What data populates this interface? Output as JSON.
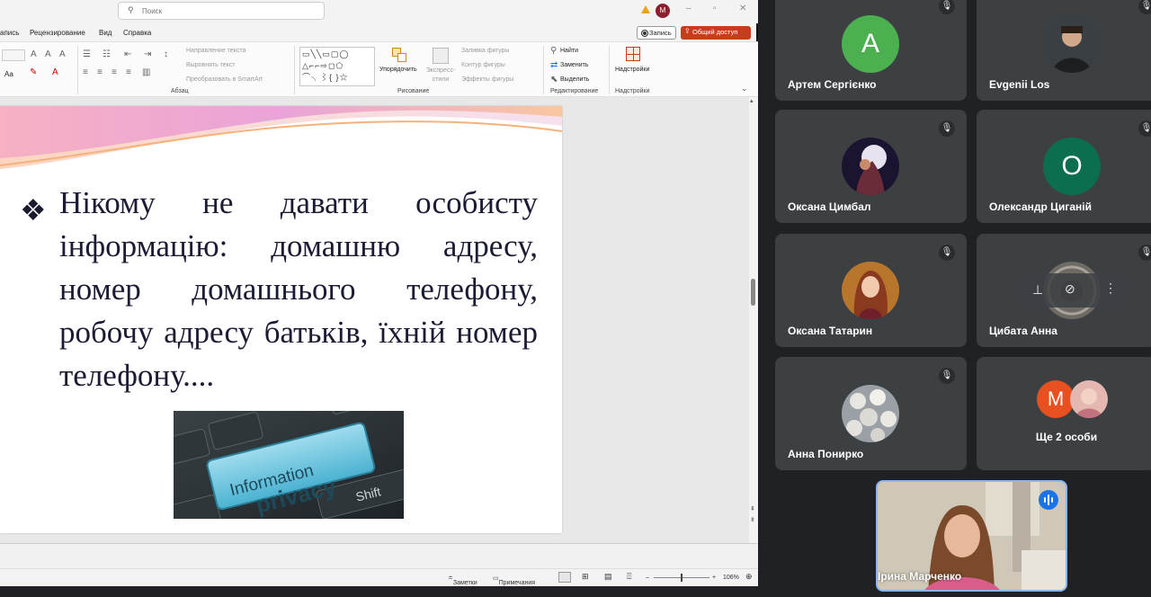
{
  "ppt": {
    "search_placeholder": "Поиск",
    "account_initial": "М",
    "menu": [
      "апись",
      "Рецензирование",
      "Вид",
      "Справка"
    ],
    "record_label": "Запись",
    "share_label": "Общий доступ",
    "ribbon": {
      "font_size_label": "Aa",
      "text_direction": "Направление текста",
      "align_text": "Выровнять текст",
      "convert_smartart": "Преобразовать в SmartArt",
      "paragraph_group": "Абзац",
      "arrange": "Упорядочить",
      "quick_styles": "Экспресс-стили",
      "shape_fill": "Заливка фигуры",
      "shape_outline": "Контур фигуры",
      "shape_effects": "Эффекты фигуры",
      "drawing_group": "Рисование",
      "find": "Найти",
      "replace": "Заменить",
      "select": "Выделить",
      "editing_group": "Редактирование",
      "addins": "Надстройки",
      "addins_group": "Надстройки"
    },
    "slide": {
      "bullet": "❖",
      "text": "Нікому не давати особисту інформацію: домашню адресу, номер домашнього телефону, робочу адресу батьків, їхній номер телефону....",
      "image_line1": "Information",
      "image_line2": "privacy",
      "image_key": "Shift"
    },
    "status": {
      "notes": "Заметки",
      "comments": "Примечания",
      "zoom": "106%"
    }
  },
  "meet": {
    "participants": [
      {
        "name": "Артем Сергієнко",
        "initial": "А",
        "color": "#34a853"
      },
      {
        "name": "Evgenii Los"
      },
      {
        "name": "Оксана Цимбал"
      },
      {
        "name": "Олександр Циганій",
        "initial": "О",
        "color": "#0b6e4f"
      },
      {
        "name": "Оксана Татарин"
      },
      {
        "name": "Цибата Анна"
      },
      {
        "name": "Анна Понирко"
      }
    ],
    "more": {
      "label": "Ще 2 особи",
      "initial": "М",
      "color": "#e8501f"
    },
    "self": {
      "name": "Ірина Марченко"
    }
  }
}
